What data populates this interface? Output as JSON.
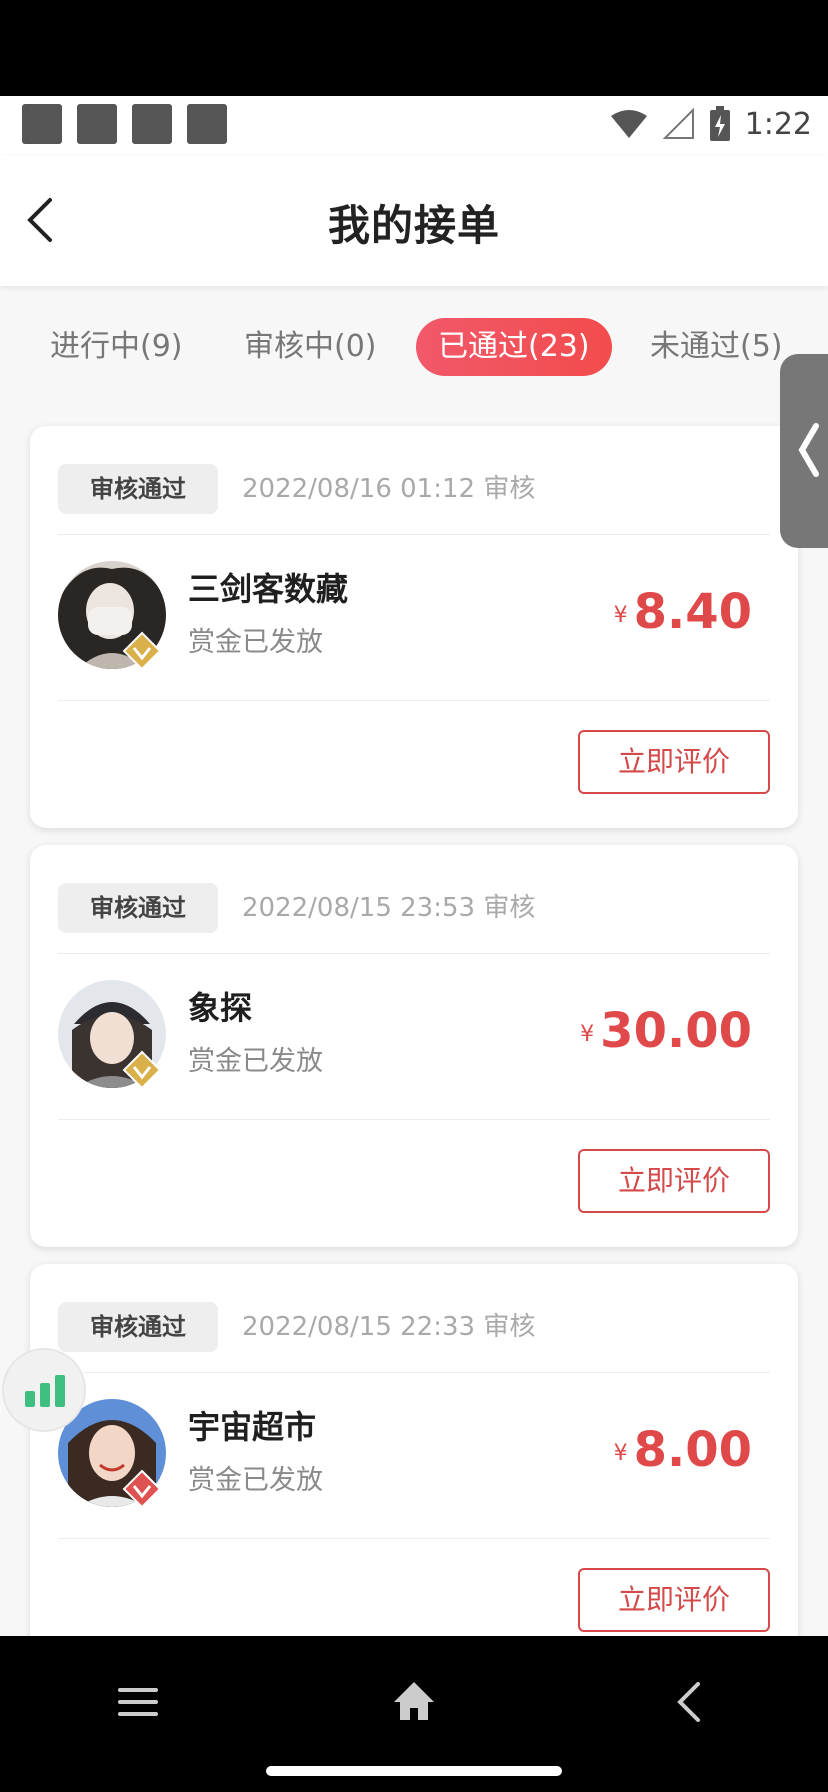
{
  "status_bar": {
    "time": "1:22",
    "icons": [
      "notification-square-icon",
      "notification-square-icon",
      "notification-square-icon",
      "notification-square-icon",
      "wifi-icon",
      "signal-icon",
      "battery-icon"
    ]
  },
  "header": {
    "title": "我的接单",
    "back_icon": "back-chevron-icon"
  },
  "tabs": [
    {
      "label": "进行中(9)",
      "active": false
    },
    {
      "label": "审核中(0)",
      "active": false
    },
    {
      "label": "已通过(23)",
      "active": true
    },
    {
      "label": "未通过(5)",
      "active": false
    }
  ],
  "orders": [
    {
      "status": "审核通过",
      "timestamp": "2022/08/16 01:12 审核",
      "name": "三剑客数藏",
      "subtitle": "赏金已发放",
      "currency": "¥",
      "amount": "8.40",
      "action": "立即评价",
      "vip_color": "#d9b04a"
    },
    {
      "status": "审核通过",
      "timestamp": "2022/08/15 23:53 审核",
      "name": "象探",
      "subtitle": "赏金已发放",
      "currency": "¥",
      "amount": "30.00",
      "action": "立即评价",
      "vip_color": "#d9b04a"
    },
    {
      "status": "审核通过",
      "timestamp": "2022/08/15 22:33 审核",
      "name": "宇宙超市",
      "subtitle": "赏金已发放",
      "currency": "¥",
      "amount": "8.00",
      "action": "立即评价",
      "vip_color": "#e05252"
    }
  ],
  "colors": {
    "accent": "#f24c4c",
    "price": "#e04949",
    "button_border": "#d44a4a"
  },
  "navbar": {
    "icons": [
      "menu-icon",
      "home-icon",
      "back-icon"
    ]
  }
}
